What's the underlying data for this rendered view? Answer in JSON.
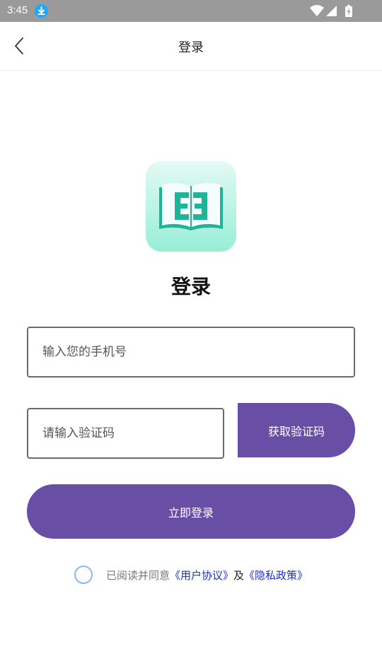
{
  "status_bar": {
    "time": "3:45"
  },
  "header": {
    "title": "登录"
  },
  "main": {
    "title": "登录"
  },
  "form": {
    "phone_placeholder": "输入您的手机号",
    "phone_value": "",
    "code_placeholder": "请输入验证码",
    "code_value": "",
    "get_code_label": "获取验证码",
    "login_label": "立即登录"
  },
  "agreement": {
    "checked": false,
    "prefix": "已阅读并同意",
    "user_agreement": "《用户协议》",
    "and": "及",
    "privacy_policy": "《隐私政策》"
  },
  "colors": {
    "primary": "#684ea4",
    "logo_teal": "#1fb496",
    "link": "#1a2fd4",
    "status_bar": "#9a9a9a"
  },
  "icons": [
    "download-icon",
    "wifi-icon",
    "signal-icon",
    "battery-icon",
    "back-arrow-icon",
    "app-logo-book-icon"
  ]
}
